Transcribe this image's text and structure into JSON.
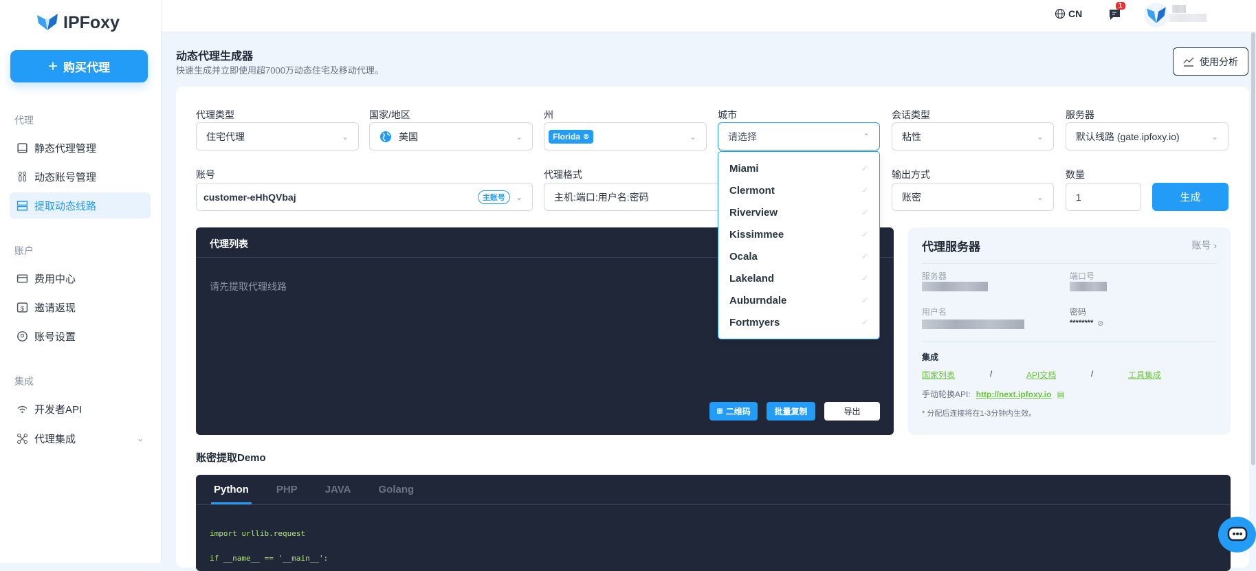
{
  "brand": {
    "name": "IPFoxy"
  },
  "sidebar": {
    "buy_label": "购买代理",
    "sections": [
      {
        "title": "代理",
        "items": [
          {
            "label": "静态代理管理",
            "icon": "monitor-icon"
          },
          {
            "label": "动态账号管理",
            "icon": "users-icon"
          },
          {
            "label": "提取动态线路",
            "icon": "server-icon",
            "active": true
          }
        ]
      },
      {
        "title": "账户",
        "items": [
          {
            "label": "费用中心",
            "icon": "wallet-icon"
          },
          {
            "label": "邀请返现",
            "icon": "dollar-icon"
          },
          {
            "label": "账号设置",
            "icon": "user-icon"
          }
        ]
      },
      {
        "title": "集成",
        "items": [
          {
            "label": "开发者API",
            "icon": "wifi-icon"
          },
          {
            "label": "代理集成",
            "icon": "integration-icon"
          }
        ]
      }
    ]
  },
  "header": {
    "language": "CN",
    "notifications": "1"
  },
  "page": {
    "title": "动态代理生成器",
    "subtitle": "快速生成并立即使用超7000万动态住宅及移动代理。",
    "analyze_label": "使用分析"
  },
  "form": {
    "proxy_type": {
      "label": "代理类型",
      "value": "住宅代理"
    },
    "country": {
      "label": "国家/地区",
      "value": "美国"
    },
    "state": {
      "label": "州",
      "tag": "Florida"
    },
    "city": {
      "label": "城市",
      "placeholder": "请选择",
      "options": [
        "Miami",
        "Clermont",
        "Riverview",
        "Kissimmee",
        "Ocala",
        "Lakeland",
        "Auburndale",
        "Fortmyers"
      ]
    },
    "session": {
      "label": "会话类型",
      "value": "粘性"
    },
    "server": {
      "label": "服务器",
      "value": "默认线路 (gate.ipfoxy.io)"
    },
    "account": {
      "label": "账号",
      "value": "customer-eHhQVbaj",
      "badge": "主账号"
    },
    "format": {
      "label": "代理格式",
      "value": "主机:端口:用户名:密码"
    },
    "output": {
      "label": "输出方式",
      "value": "账密"
    },
    "quantity": {
      "label": "数量",
      "value": "1"
    },
    "generate_label": "生成"
  },
  "proxy_list": {
    "title": "代理列表",
    "placeholder": "请先提取代理线路",
    "qr_label": "二维码",
    "copy_label": "批量复制",
    "export_label": "导出"
  },
  "proxy_server": {
    "title": "代理服务器",
    "account_link": "账号",
    "server_label": "服务器",
    "port_label": "端口号",
    "username_label": "用户名",
    "password_label": "密码",
    "password_value": "********",
    "integration_title": "集成",
    "links": [
      "国家列表",
      "API文档",
      "工具集成"
    ],
    "rotate_label": "手动轮换API:",
    "rotate_url": "http://next.ipfoxy.io",
    "note": "* 分配后连接将在1-3分钟内生效。"
  },
  "demo": {
    "title": "账密提取Demo",
    "tabs": [
      "Python",
      "PHP",
      "JAVA",
      "Golang"
    ],
    "code": [
      "import urllib.request",
      "if __name__ == '__main__':"
    ]
  },
  "colors": {
    "accent": "#229cf7",
    "dark": "#1f2739",
    "link": "#6cc33d"
  }
}
